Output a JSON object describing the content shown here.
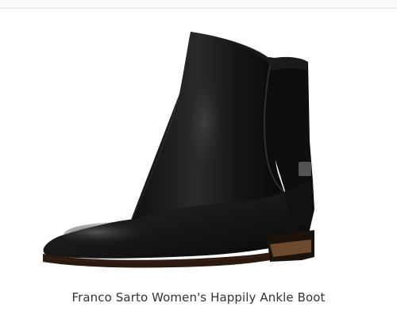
{
  "product": {
    "title": "Franco Sarto Women's Happily Ankle Boot",
    "image_icon": "ankle-boot-image",
    "colors": {
      "boot": "#111111",
      "boot_highlight": "#3a3a3a",
      "sole": "#2b1a10",
      "heel_edge": "#6b4a2e"
    }
  }
}
